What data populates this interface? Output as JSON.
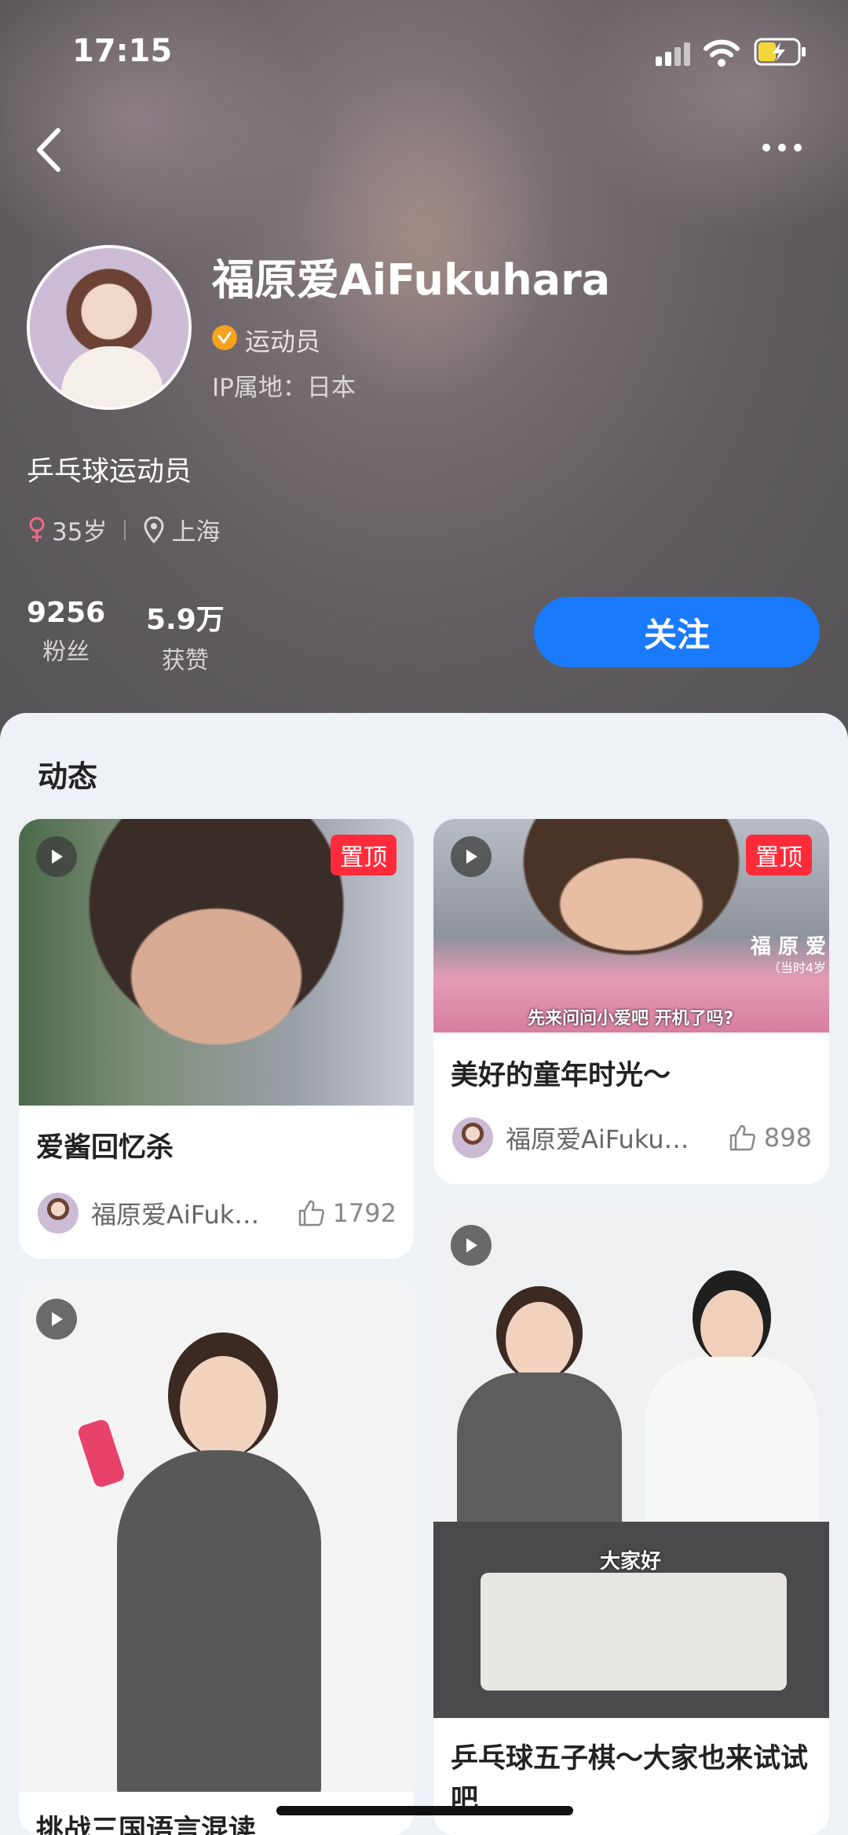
{
  "status_bar": {
    "time": "17:15"
  },
  "profile": {
    "name": "福原爱AiFukuhara",
    "role": "运动员",
    "ip_location": "IP属地：日本",
    "bio": "乒乓球运动员",
    "age": "35岁",
    "city": "上海",
    "stats": [
      {
        "value": "9256",
        "label": "粉丝"
      },
      {
        "value": "5.9万",
        "label": "获赞"
      }
    ],
    "follow_label": "关注"
  },
  "feed": {
    "section_title": "动态",
    "pinned_label": "置顶",
    "cards": [
      {
        "title": "爱酱回忆杀",
        "author": "福原爱AiFuk…",
        "likes": "1792",
        "pinned": true
      },
      {
        "title": "美好的童年时光～",
        "author": "福原爱AiFuku…",
        "likes": "898",
        "pinned": true,
        "overlay_name": "福 原 爱",
        "overlay_sub": "（当时4岁",
        "subtitle": "先来问问小爱吧 开机了吗?"
      },
      {
        "title": "挑战三国语言混读",
        "pinned": false
      },
      {
        "title": "乒乓球五子棋～大家也来试试吧",
        "pinned": false,
        "overlay_text": "大家好"
      }
    ]
  },
  "colors": {
    "accent": "#1a7afc",
    "pin_badge": "#ff2b3a",
    "verified": "#f6a21f"
  },
  "icons": [
    "back-icon",
    "more-icon",
    "verified-icon",
    "female-icon",
    "location-icon",
    "play-icon",
    "like-icon"
  ]
}
